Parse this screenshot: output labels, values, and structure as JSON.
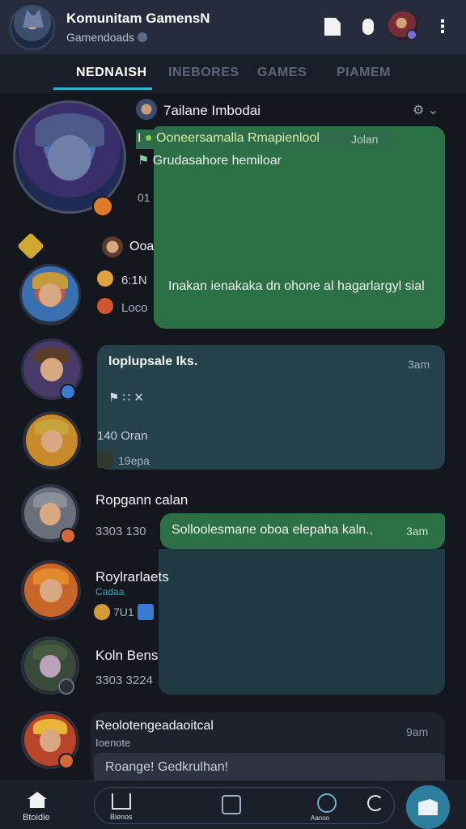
{
  "header": {
    "title": "Komunitam GamensN",
    "subtitle": "Gamendoads",
    "icons": [
      "document-icon",
      "mic-icon",
      "profile-avatar",
      "more-icon"
    ]
  },
  "tabs": [
    "NEDNAISH",
    "INEBORES",
    "GAMES",
    "PIAMEM"
  ],
  "active_tab": 0,
  "group": {
    "name": "7ailane Imbodai",
    "highlight_text": "Ooneersamalla Rmapienlool",
    "highlight_time": "Jolan",
    "subtext": "Grudasahore hemiloar",
    "count": "01",
    "message": "Inakan ienakaka dn ohone al hagarlargyl sial",
    "sender": "Ooa",
    "sender_meta1": "6:1N",
    "sender_meta2": "Loco"
  },
  "chats": [
    {
      "title": "Ioplupsale Iks.",
      "time": "3am",
      "icons": "⚑ ∷ ✕",
      "sub1": "140 Oran",
      "sub2": "19epa"
    },
    {
      "name": "Ropgann calan",
      "meta": "3303 130",
      "message": "Solloolesmane oboa elepaha kaln.,",
      "time": "3am"
    },
    {
      "name": "Roylrarlaets",
      "meta": "Cadaa",
      "meta2": "7U1"
    },
    {
      "name": "Koln Bens",
      "meta": "3303 3224"
    },
    {
      "name": "Reolotengeadaoitcal",
      "meta": "Ioenote",
      "time": "9am",
      "preview": "Roange! Gedkrulhan!"
    }
  ],
  "bottom_nav": {
    "home_label": "Btoidie",
    "item2_label": "Bienos",
    "item4_label": "Aanoo"
  },
  "colors": {
    "accent": "#2fb4c8",
    "bubble_green": "#2c7046",
    "bubble_teal": "#24414c",
    "background": "#15171f"
  }
}
